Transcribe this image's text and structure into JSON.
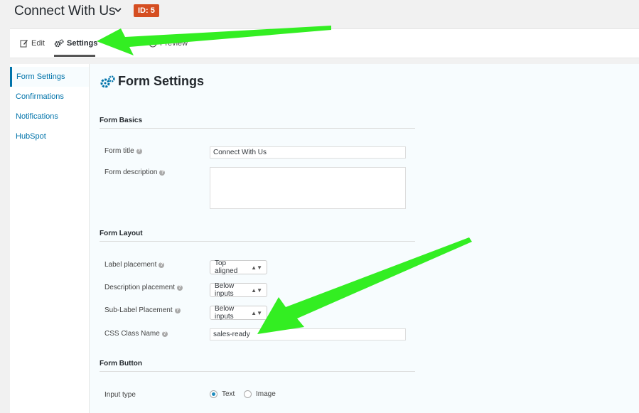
{
  "header": {
    "title": "Connect With Us",
    "id_badge": "ID: 5"
  },
  "toolbar": {
    "edit_label": "Edit",
    "settings_label": "Settings",
    "preview_label": "Preview"
  },
  "sidebar": {
    "items": [
      {
        "label": "Form Settings"
      },
      {
        "label": "Confirmations"
      },
      {
        "label": "Notifications"
      },
      {
        "label": "HubSpot"
      }
    ]
  },
  "main": {
    "title": "Form Settings",
    "basics": {
      "heading": "Form Basics",
      "form_title_label": "Form title",
      "form_title_value": "Connect With Us",
      "form_description_label": "Form description",
      "form_description_value": ""
    },
    "layout": {
      "heading": "Form Layout",
      "label_placement_label": "Label placement",
      "label_placement_value": "Top aligned",
      "description_placement_label": "Description placement",
      "description_placement_value": "Below inputs",
      "sublabel_placement_label": "Sub-Label Placement",
      "sublabel_placement_value": "Below inputs",
      "css_class_label": "CSS Class Name",
      "css_class_value": "sales-ready"
    },
    "button": {
      "heading": "Form Button",
      "input_type_label": "Input type",
      "options": [
        {
          "label": "Text",
          "selected": true
        },
        {
          "label": "Image",
          "selected": false
        }
      ]
    }
  },
  "colors": {
    "accent": "#0073aa",
    "badge": "#d54e21",
    "annotation_arrow": "#33ee22"
  }
}
